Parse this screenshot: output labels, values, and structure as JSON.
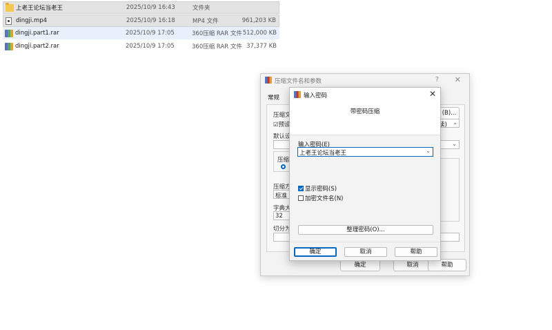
{
  "files": [
    {
      "name": "上老王论坛当老王",
      "date": "2025/10/9 16:43",
      "type": "文件夹",
      "size": "",
      "icon": "folder-icon",
      "state": "selected"
    },
    {
      "name": "dingji.mp4",
      "date": "2025/10/9 16:18",
      "type": "MP4 文件",
      "size": "961,203 KB",
      "icon": "video-file-icon",
      "state": "selected"
    },
    {
      "name": "dingji.part1.rar",
      "date": "2025/10/9 17:05",
      "type": "360压缩 RAR 文件",
      "size": "512,000 KB",
      "icon": "rar-archive-icon",
      "state": "hover"
    },
    {
      "name": "dingji.part2.rar",
      "date": "2025/10/9 17:05",
      "type": "360压缩 RAR 文件",
      "size": "37,377 KB",
      "icon": "rar-archive-icon",
      "state": "normal"
    }
  ],
  "back_dialog": {
    "title": "压缩文件名和参数",
    "help": "?",
    "close": "✕",
    "tab": "常规",
    "labels": {
      "archive_name": "压缩文",
      "archive_option": "☑预设",
      "default_settings": "默认设",
      "compress_format": "压缩",
      "compress_method": "压缩方",
      "method_value": "标准",
      "dictionary": "字典大",
      "dictionary_value": "32",
      "split": "切分为",
      "browse_suffix": "(B)...",
      "combo_suffix": "读)"
    },
    "buttons": {
      "ok": "确定",
      "cancel": "取消",
      "help": "帮助"
    }
  },
  "password_dialog": {
    "title": "输入密码",
    "close": "✕",
    "header": "带密码压缩",
    "password_label": "输入密码(E)",
    "password_value": "上老王论坛当老王",
    "show_password": "显示密码(S)",
    "show_password_checked": true,
    "encrypt_names": "加密文件名(N)",
    "encrypt_names_checked": false,
    "organize_button": "整理密码(O)...",
    "buttons": {
      "ok": "确定",
      "cancel": "取消",
      "help": "帮助"
    }
  }
}
